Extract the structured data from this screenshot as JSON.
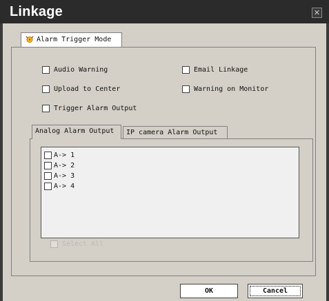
{
  "window": {
    "title": "Linkage",
    "close_glyph": "✕"
  },
  "outer_tab": {
    "label": "Alarm Trigger Mode",
    "icon": "alarm-bell-icon"
  },
  "trigger_options": {
    "audio_warning": "Audio Warning",
    "email_linkage": "Email Linkage",
    "upload_to_center": "Upload to Center",
    "warning_on_monitor": "Warning on Monitor",
    "trigger_alarm_output": "Trigger Alarm Output"
  },
  "inner_tabs": [
    {
      "label": "Analog Alarm Output",
      "active": true
    },
    {
      "label": "IP camera Alarm Output",
      "active": false
    }
  ],
  "outputs": [
    {
      "label": "A-> 1",
      "checked": false
    },
    {
      "label": "A-> 2",
      "checked": false
    },
    {
      "label": "A-> 3",
      "checked": false
    },
    {
      "label": "A-> 4",
      "checked": false
    }
  ],
  "select_all": {
    "label": "Select All",
    "enabled": false
  },
  "buttons": {
    "ok": "OK",
    "cancel": "Cancel"
  }
}
